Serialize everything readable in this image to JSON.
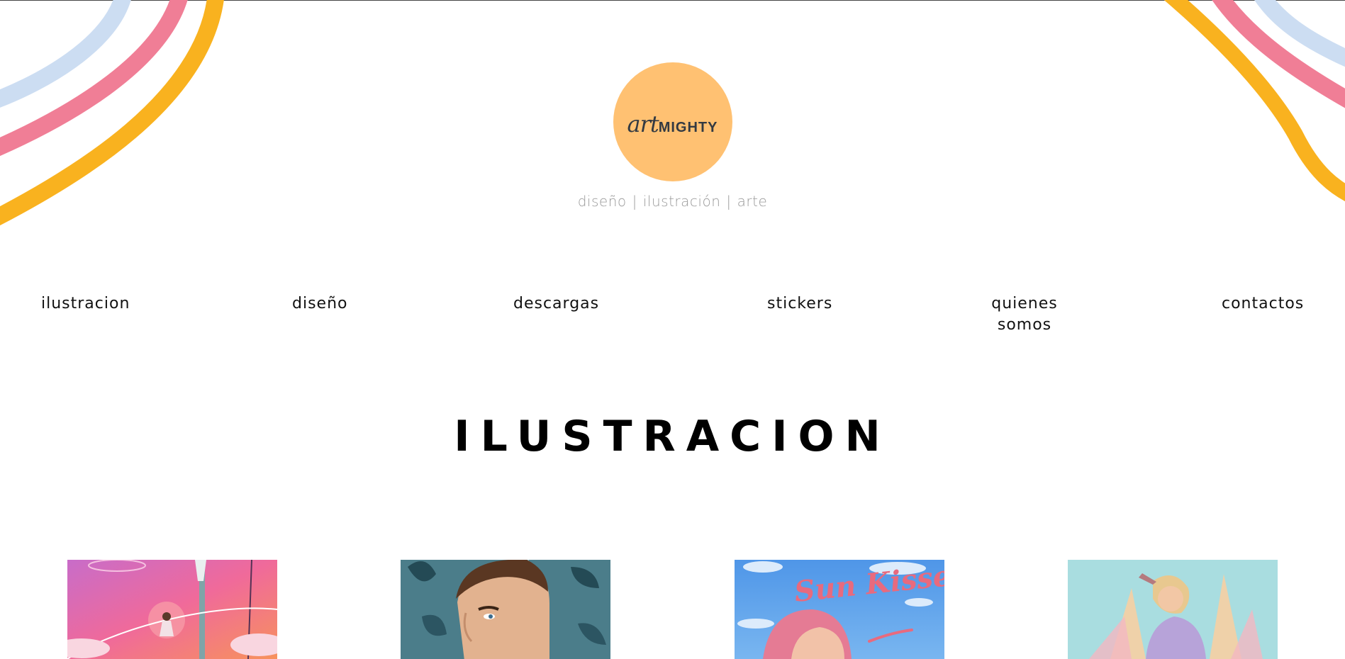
{
  "logo": {
    "script": "art",
    "bold": "MIGHTY",
    "tagline": [
      "diseño",
      "ilustración",
      "arte"
    ]
  },
  "nav": [
    {
      "line1": "ilustracion",
      "line2": ""
    },
    {
      "line1": "diseño",
      "line2": ""
    },
    {
      "line1": "descargas",
      "line2": ""
    },
    {
      "line1": "stickers",
      "line2": ""
    },
    {
      "line1": "quienes",
      "line2": "somos"
    },
    {
      "line1": "contactos",
      "line2": ""
    }
  ],
  "section": {
    "title": "ILUSTRACION"
  },
  "gallery": [
    {
      "subject": "girl-swing-pink-sky",
      "text": ""
    },
    {
      "subject": "man-portrait-leaves",
      "text": ""
    },
    {
      "subject": "sun-kissed-girl",
      "text": "Sun Kissed"
    },
    {
      "subject": "girl-purple-sweater",
      "text": ""
    }
  ],
  "colors": {
    "logo_circle": "#FFC172",
    "ribbon_yellow": "#F9B21F",
    "ribbon_pink": "#F07E96",
    "ribbon_blue": "#CCDDF2",
    "text": "#111111",
    "tagline": "#9A9A9A"
  }
}
